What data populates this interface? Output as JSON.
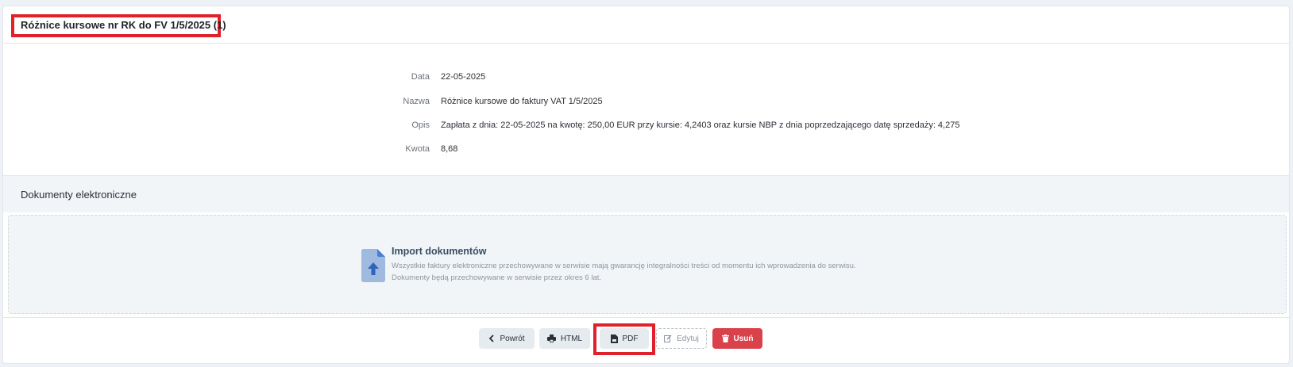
{
  "header": {
    "title": "Różnice kursowe nr RK do FV 1/5/2025 (1)"
  },
  "details": [
    {
      "label": "Data",
      "value": "22-05-2025"
    },
    {
      "label": "Nazwa",
      "value": "Różnice kursowe do faktury VAT 1/5/2025"
    },
    {
      "label": "Opis",
      "value": "Zapłata z dnia: 22-05-2025 na kwotę: 250,00 EUR przy kursie: 4,2403 oraz kursie NBP z dnia poprzedzającego datę sprzedaży: 4,275"
    },
    {
      "label": "Kwota",
      "value": "8,68"
    }
  ],
  "documents": {
    "section_title": "Dokumenty elektroniczne",
    "import_title": "Import dokumentów",
    "import_text_1": "Wszystkie faktury elektroniczne przechowywane w serwisie mają gwarancję integralności treści od momentu ich wprowadzenia do serwisu.",
    "import_text_2": "Dokumenty będą przechowywane w serwisie przez okres 6 lat.",
    "icon": "file-upload-icon"
  },
  "buttons": {
    "back": "Powrót",
    "html": "HTML",
    "pdf": "PDF",
    "edit": "Edytuj",
    "delete": "Usuń"
  },
  "colors": {
    "highlight": "#e0202a",
    "danger": "#d9424a",
    "accent": "#4a7fd1"
  }
}
